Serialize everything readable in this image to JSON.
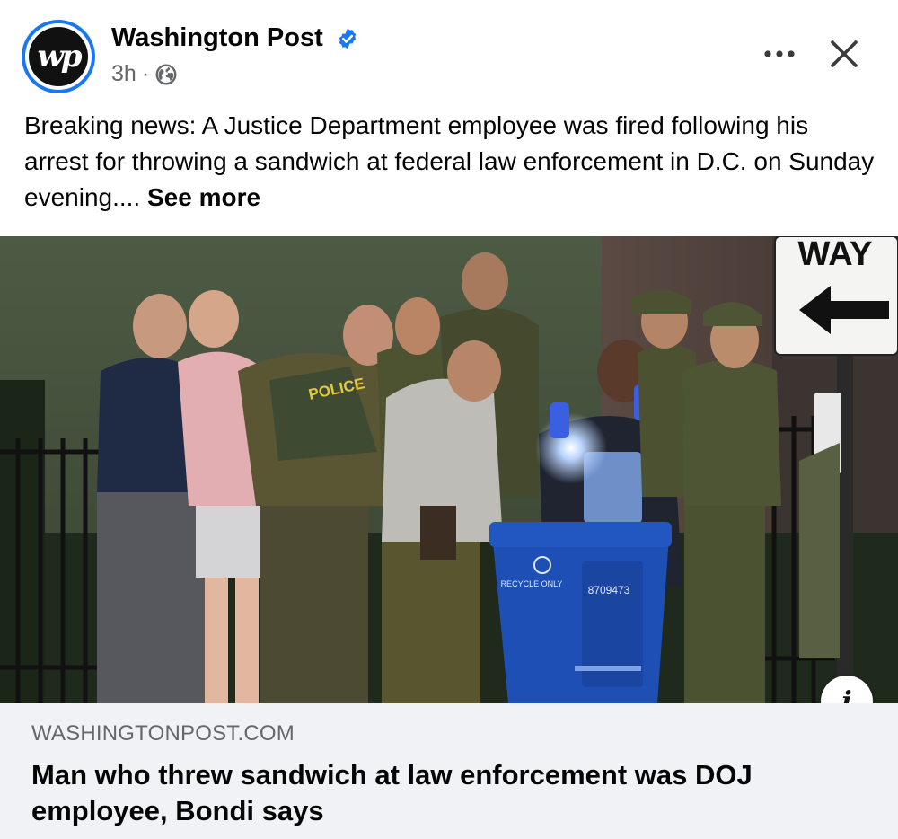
{
  "post": {
    "page_name": "Washington Post",
    "avatar_text": "wp",
    "time": "3h",
    "separator": "·",
    "text": "Breaking news: A Justice Department employee was fired following his arrest for throwing a sandwich at federal law enforcement in D.C. on Sunday evening....",
    "see_more_label": "See more"
  },
  "photo": {
    "sign_text": "WAY",
    "bin_label": "RECYCLE ONLY",
    "bin_number": "8709473",
    "vest_text": "POLICE"
  },
  "link": {
    "domain": "WASHINGTONPOST.COM",
    "title": "Man who threw sandwich at law enforcement was DOJ employee, Bondi says",
    "info_icon": "i"
  },
  "colors": {
    "verified_blue": "#1877f2",
    "secondary_text": "#65676b",
    "preview_bg": "#f0f2f5"
  },
  "icons": [
    "verified-badge-icon",
    "globe-icon",
    "more-options-icon",
    "close-icon",
    "info-icon"
  ]
}
